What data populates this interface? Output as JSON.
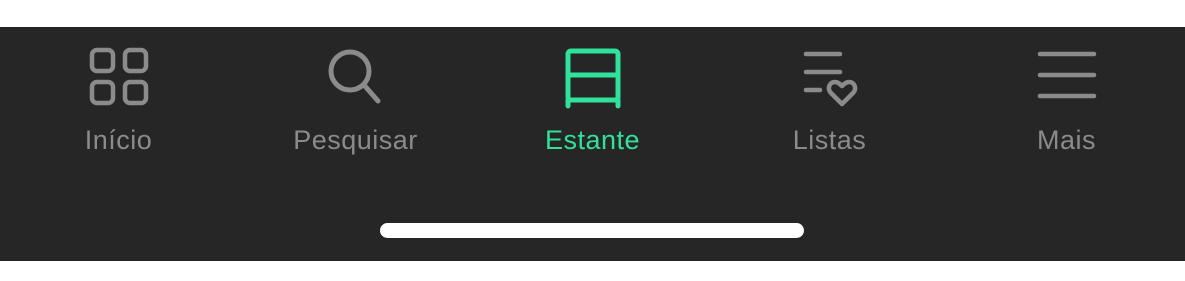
{
  "colors": {
    "bar_background": "#262626",
    "inactive": "#8b8b8b",
    "active": "#2fe19a",
    "home_indicator": "#ffffff"
  },
  "tabs": [
    {
      "label": "Início",
      "icon": "grid-icon",
      "active": false
    },
    {
      "label": "Pesquisar",
      "icon": "search-icon",
      "active": false
    },
    {
      "label": "Estante",
      "icon": "bookshelf-icon",
      "active": true
    },
    {
      "label": "Listas",
      "icon": "list-heart-icon",
      "active": false
    },
    {
      "label": "Mais",
      "icon": "menu-icon",
      "active": false
    }
  ]
}
